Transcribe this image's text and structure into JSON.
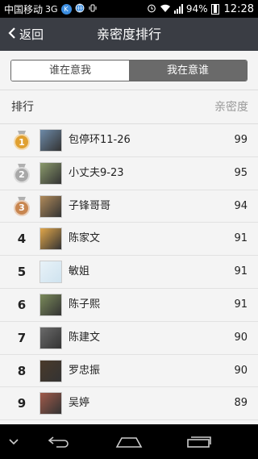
{
  "status_bar": {
    "carrier": "中国移动",
    "network": "3G",
    "battery": "94%",
    "time": "12:28",
    "icons": [
      "k-app-icon",
      "globe-icon",
      "vibrate-icon",
      "alarm-icon",
      "wifi-icon",
      "signal-icon",
      "battery-icon"
    ]
  },
  "header": {
    "back_label": "返回",
    "title": "亲密度排行"
  },
  "tabs": [
    {
      "label": "谁在意我",
      "selected": false
    },
    {
      "label": "我在意谁",
      "selected": true
    }
  ],
  "list_header": {
    "left": "排行",
    "right": "亲密度"
  },
  "rows": [
    {
      "rank": "1",
      "medal": "gold",
      "name": "包停环11-26",
      "score": "99",
      "avatar": "#6d8aa8"
    },
    {
      "rank": "2",
      "medal": "silver",
      "name": "小丈夫9-23",
      "score": "95",
      "avatar": "#8a9a6b"
    },
    {
      "rank": "3",
      "medal": "bronze",
      "name": "子锋哥哥",
      "score": "94",
      "avatar": "#b08a5a"
    },
    {
      "rank": "4",
      "medal": "",
      "name": "陈家文",
      "score": "91",
      "avatar": "#e0a64a"
    },
    {
      "rank": "5",
      "medal": "",
      "name": "敏姐",
      "score": "91",
      "avatar": "#cfe3ef"
    },
    {
      "rank": "6",
      "medal": "",
      "name": "陈子熙",
      "score": "91",
      "avatar": "#7a8a5a"
    },
    {
      "rank": "7",
      "medal": "",
      "name": "陈建文",
      "score": "90",
      "avatar": "#6a6a6a"
    },
    {
      "rank": "8",
      "medal": "",
      "name": "罗忠振",
      "score": "90",
      "avatar": "#4a3a2a"
    },
    {
      "rank": "9",
      "medal": "",
      "name": "吴婷",
      "score": "89",
      "avatar": "#a05a4a"
    }
  ],
  "colors": {
    "header_bg": "#3a3d44",
    "gold": "#e0a030",
    "silver": "#a8a8a8",
    "bronze": "#c88650"
  },
  "nav": [
    "chevron-down-icon",
    "back-icon",
    "home-icon",
    "recents-icon"
  ]
}
